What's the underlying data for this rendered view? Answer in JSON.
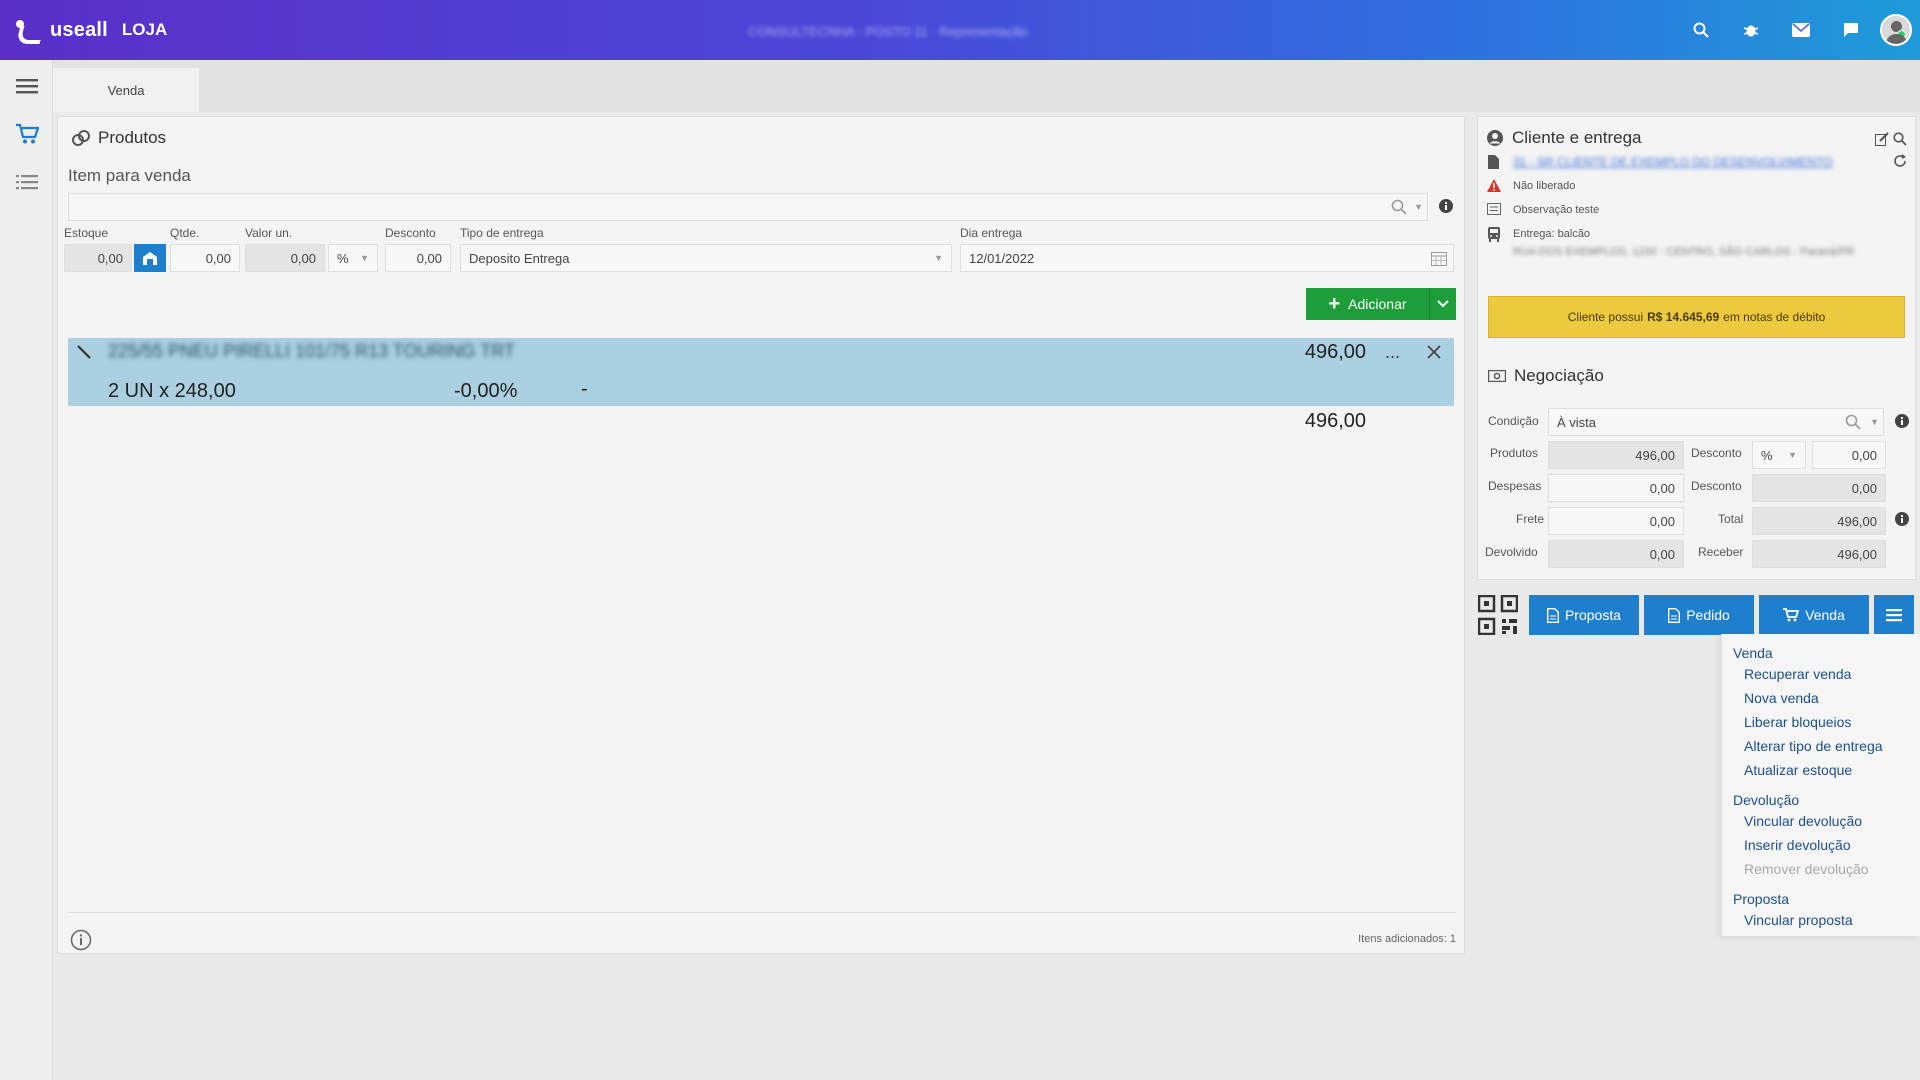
{
  "app": {
    "logo_text": "useall",
    "logo_sub": "LOJA",
    "company": "CONSULTECNHA - POSTO 11 · Representação"
  },
  "topbar": {
    "icons": [
      "search-icon",
      "bug-icon",
      "mail-icon",
      "chat-icon"
    ]
  },
  "sidebar": {
    "items": [
      {
        "name": "menu-icon",
        "glyph": "☰"
      },
      {
        "name": "cart-icon",
        "glyph": "🛒"
      },
      {
        "name": "list-icon",
        "glyph": "☷"
      }
    ]
  },
  "tabs": [
    {
      "label": "Venda"
    }
  ],
  "produtos": {
    "title": "Produtos",
    "item_label": "Item para venda",
    "fields": {
      "estoque_label": "Estoque",
      "estoque_value": "0,00",
      "qtde_label": "Qtde.",
      "qtde_value": "0,00",
      "valor_label": "Valor un.",
      "valor_value": "0,00",
      "percent_value": "%",
      "desconto_label": "Desconto",
      "desconto_value": "0,00",
      "tipo_label": "Tipo de entrega",
      "tipo_value": "Deposito Entrega",
      "dia_label": "Dia entrega",
      "dia_value": "12/01/2022"
    },
    "add_button": "Adicionar",
    "item": {
      "name": "225/55 PNEU PIRELLI 101/75 R13 TOURING TRT",
      "price": "496,00",
      "qty": "2 UN x 248,00",
      "discount": "-0,00%",
      "dash": "-",
      "more": "..."
    },
    "total": "496,00",
    "footer": "Itens adicionados: 1"
  },
  "cliente": {
    "title": "Cliente e entrega",
    "name": "31 - SR CLIENTE DE EXEMPLO DO DESENVOLVIMENTO",
    "status": "Não liberado",
    "obs": "Observação teste",
    "entrega": "Entrega: balcão",
    "endereco": "RUA DOS EXEMPLOS, 1234 - CENTRO, SÃO CARLOS - Paraná/PR",
    "debito_prefix": "Cliente possui",
    "debito_value": "R$ 14.645,69",
    "debito_suffix": "em notas de débito"
  },
  "negociacao": {
    "title": "Negociação",
    "condicao_label": "Condição",
    "condicao_value": "À vista",
    "produtos_label": "Produtos",
    "produtos_value": "496,00",
    "desconto_label": "Desconto",
    "desconto_unit": "%",
    "desconto_value": "0,00",
    "despesas_label": "Despesas",
    "despesas_value": "0,00",
    "desconto2_label": "Desconto",
    "desconto2_value": "0,00",
    "frete_label": "Frete",
    "frete_value": "0,00",
    "total_label": "Total",
    "total_value": "496,00",
    "devolvido_label": "Devolvido",
    "devolvido_value": "0,00",
    "receber_label": "Receber",
    "receber_value": "496,00"
  },
  "actions": {
    "proposta": "Proposta",
    "pedido": "Pedido",
    "venda": "Venda"
  },
  "menu": {
    "groups": [
      {
        "label": "Venda",
        "items": [
          "Recuperar venda",
          "Nova venda",
          "Liberar bloqueios",
          "Alterar tipo de entrega",
          "Atualizar estoque"
        ]
      },
      {
        "label": "Devolução",
        "items": [
          "Vincular devolução",
          "Inserir devolução",
          "Remover devolução"
        ]
      },
      {
        "label": "Proposta",
        "items": [
          "Vincular proposta"
        ]
      }
    ]
  },
  "colors": {
    "accent": "#1f7fcf",
    "add_green": "#1e9e3a",
    "selected_row": "#a9cfe0",
    "warning_yellow": "#ecc93f",
    "alert_red": "#d9342b"
  }
}
